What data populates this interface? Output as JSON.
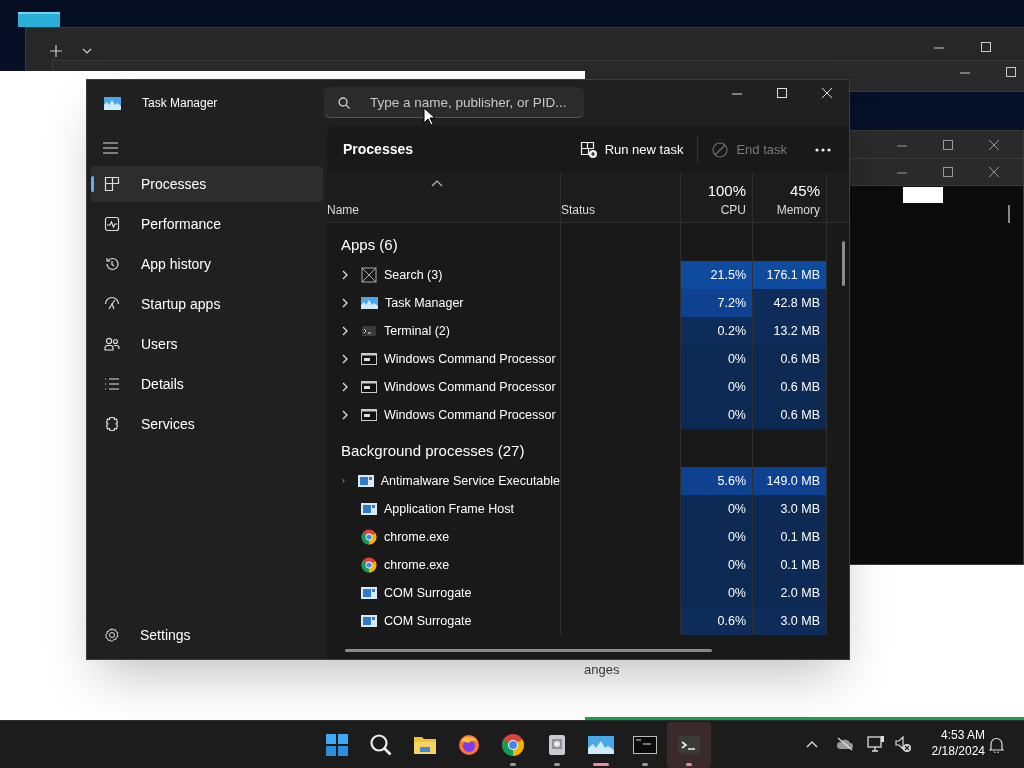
{
  "desktop": {
    "behind_text": "anges"
  },
  "window": {
    "title": "Task Manager",
    "search": {
      "placeholder": "Type a name, publisher, or PID..."
    }
  },
  "sidebar": {
    "items": [
      {
        "label": "Processes",
        "selected": true
      },
      {
        "label": "Performance",
        "selected": false
      },
      {
        "label": "App history",
        "selected": false
      },
      {
        "label": "Startup apps",
        "selected": false
      },
      {
        "label": "Users",
        "selected": false
      },
      {
        "label": "Details",
        "selected": false
      },
      {
        "label": "Services",
        "selected": false
      }
    ],
    "settings": "Settings"
  },
  "toolbar": {
    "title": "Processes",
    "buttons": [
      {
        "label": "Run new task",
        "disabled": false
      },
      {
        "label": "End task",
        "disabled": true
      }
    ]
  },
  "table": {
    "columns": [
      {
        "label": "Name"
      },
      {
        "label": "Status"
      },
      {
        "label": "CPU",
        "total": "100%"
      },
      {
        "label": "Memory",
        "total": "45%"
      }
    ],
    "rows": [
      {
        "kind": "group",
        "label": "Apps (6)"
      },
      {
        "kind": "frame",
        "name": "Search (3)",
        "expandable": true,
        "cpu": {
          "text": "21.5%",
          "color": "#0e4a9e"
        },
        "memory": {
          "text": "176.1 MB",
          "color": "#0e4a9e"
        }
      },
      {
        "kind": "taskmgr",
        "name": "Task Manager",
        "expandable": true,
        "cpu": {
          "text": "7.2%",
          "color": "#0e4290"
        },
        "memory": {
          "text": "42.8 MB",
          "color": "#0d2c5a"
        }
      },
      {
        "kind": "terminal",
        "name": "Terminal (2)",
        "expandable": true,
        "cpu": {
          "text": "0.2%",
          "color": "#0d2c5a"
        },
        "memory": {
          "text": "13.2 MB",
          "color": "#0d2c5a"
        }
      },
      {
        "kind": "cmd",
        "name": "Windows Command Processor",
        "expandable": true,
        "cpu": {
          "text": "0%",
          "color": "#0d2a55"
        },
        "memory": {
          "text": "0.6 MB",
          "color": "#0d2a55"
        }
      },
      {
        "kind": "cmd",
        "name": "Windows Command Processor",
        "expandable": true,
        "cpu": {
          "text": "0%",
          "color": "#0d2a55"
        },
        "memory": {
          "text": "0.6 MB",
          "color": "#0d2a55"
        }
      },
      {
        "kind": "cmd",
        "name": "Windows Command Processor",
        "expandable": true,
        "cpu": {
          "text": "0%",
          "color": "#0d2a55"
        },
        "memory": {
          "text": "0.6 MB",
          "color": "#0d2a55"
        }
      },
      {
        "kind": "group",
        "label": "Background processes (27)"
      },
      {
        "kind": "service",
        "name": "Antimalware Service Executable",
        "expandable": true,
        "cpu": {
          "text": "5.6%",
          "color": "#0e4290"
        },
        "memory": {
          "text": "149.0 MB",
          "color": "#0e4290"
        }
      },
      {
        "kind": "service",
        "name": "Application Frame Host",
        "expandable": false,
        "cpu": {
          "text": "0%",
          "color": "#0d2a55"
        },
        "memory": {
          "text": "3.0 MB",
          "color": "#0d2a55"
        }
      },
      {
        "kind": "chrome",
        "name": "chrome.exe",
        "expandable": false,
        "cpu": {
          "text": "0%",
          "color": "#0d2a55"
        },
        "memory": {
          "text": "0.1 MB",
          "color": "#0d2a55"
        }
      },
      {
        "kind": "chrome",
        "name": "chrome.exe",
        "expandable": false,
        "cpu": {
          "text": "0%",
          "color": "#0d2a55"
        },
        "memory": {
          "text": "0.1 MB",
          "color": "#0d2a55"
        }
      },
      {
        "kind": "service",
        "name": "COM Surrogate",
        "expandable": false,
        "cpu": {
          "text": "0%",
          "color": "#0d2a55"
        },
        "memory": {
          "text": "2.0 MB",
          "color": "#0d2a55"
        }
      },
      {
        "kind": "service",
        "name": "COM Surrogate",
        "expandable": false,
        "cpu": {
          "text": "0.6%",
          "color": "#0d2c5a"
        },
        "memory": {
          "text": "3.0 MB",
          "color": "#0d2c5a"
        }
      }
    ]
  },
  "taskbar": {
    "apps": [
      {
        "running": false,
        "active": false,
        "attention": false
      },
      {
        "running": false,
        "active": false,
        "attention": false
      },
      {
        "running": false,
        "active": false,
        "attention": false
      },
      {
        "running": false,
        "active": false,
        "attention": false
      },
      {
        "running": true,
        "active": false,
        "attention": false
      },
      {
        "running": true,
        "active": false,
        "attention": false
      },
      {
        "running": true,
        "active": true,
        "attention": false
      },
      {
        "running": true,
        "active": false,
        "attention": false
      },
      {
        "running": true,
        "active": false,
        "attention": true
      }
    ],
    "time": "4:53 AM",
    "date": "2/18/2024"
  }
}
